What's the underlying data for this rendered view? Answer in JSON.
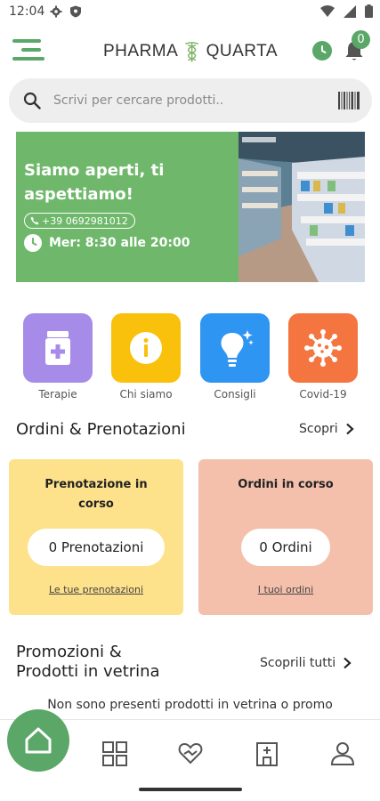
{
  "status_bar": {
    "time": "12:04"
  },
  "header": {
    "brand_left": "PHARMA",
    "brand_right": "QUARTA",
    "notification_count": "0",
    "accent_color": "#5aa767"
  },
  "search": {
    "placeholder": "Scrivi per cercare prodotti.."
  },
  "banner": {
    "title": "Siamo aperti, ti aspettiamo!",
    "phone": "+39 0692981012",
    "hours": "Mer: 8:30 alle 20:00",
    "color": "#6fb86b"
  },
  "categories": [
    {
      "label": "Terapie",
      "icon": "medicine-bottle-icon",
      "color": "#a78be8"
    },
    {
      "label": "Chi siamo",
      "icon": "info-icon",
      "color": "#f9c00c"
    },
    {
      "label": "Consigli",
      "icon": "lightbulb-icon",
      "color": "#2f95f2"
    },
    {
      "label": "Covid-19",
      "icon": "virus-icon",
      "color": "#f4753f"
    }
  ],
  "orders_section": {
    "title": "Ordini & Prenotazioni",
    "link": "Scopri"
  },
  "cards": [
    {
      "title": "Prenotazione in corso",
      "count": "0 Prenotazioni",
      "link": "Le tue prenotazioni",
      "color": "#fde18b"
    },
    {
      "title": "Ordini in corso",
      "count": "0 Ordini",
      "link": "I tuoi ordini",
      "color": "#f5c0ab"
    }
  ],
  "promo_section": {
    "title_line1": "Promozioni &",
    "title_line2": "Prodotti in vetrina",
    "link": "Scoprili tutti",
    "empty_text": "Non sono presenti prodotti in vetrina o promo"
  },
  "bottom_nav": [
    {
      "name": "home",
      "icon": "home-icon"
    },
    {
      "name": "catalog",
      "icon": "grid-icon"
    },
    {
      "name": "health",
      "icon": "heart-hand-icon"
    },
    {
      "name": "pharmacy",
      "icon": "building-icon"
    },
    {
      "name": "profile",
      "icon": "user-icon"
    }
  ]
}
